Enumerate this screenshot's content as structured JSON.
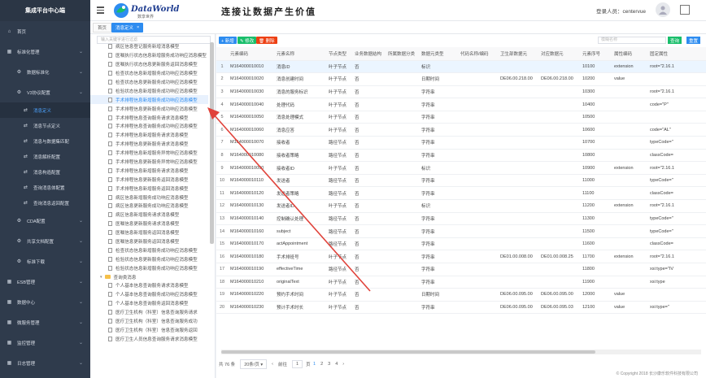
{
  "sidebar": {
    "brand": "集成平台中心端",
    "items": [
      {
        "label": "首页",
        "icon": "home-icon"
      },
      {
        "label": "标准化管理",
        "icon": "grid-icon"
      },
      {
        "label": "数据标准化",
        "icon": "gear-icon"
      },
      {
        "label": "V3协议配置",
        "icon": "gear-icon"
      },
      {
        "label": "消息定义",
        "icon": "pin-icon"
      },
      {
        "label": "消息节点定义",
        "icon": "pin-icon"
      },
      {
        "label": "消息与数据集匹配",
        "icon": "pin-icon"
      },
      {
        "label": "消息解析配置",
        "icon": "pin-icon"
      },
      {
        "label": "消息构造配置",
        "icon": "pin-icon"
      },
      {
        "label": "查询消息体配置",
        "icon": "pin-icon"
      },
      {
        "label": "查询消息返回配置",
        "icon": "pin-icon"
      },
      {
        "label": "CDA配置",
        "icon": "gear-icon"
      },
      {
        "label": "共享文档配置",
        "icon": "gear-icon"
      },
      {
        "label": "标准下载",
        "icon": "gear-icon"
      },
      {
        "label": "ESB管理",
        "icon": "grid-icon"
      },
      {
        "label": "数据中心",
        "icon": "grid-icon"
      },
      {
        "label": "微服务管理",
        "icon": "grid-icon"
      },
      {
        "label": "监控管理",
        "icon": "grid-icon"
      },
      {
        "label": "日志管理",
        "icon": "grid-icon"
      }
    ]
  },
  "header": {
    "logo_text": "DataWorld",
    "logo_sub": "数享世界",
    "slogan": "连接让数据产生价值",
    "login_label": "登录人员：centervue"
  },
  "tabs": {
    "home": "首页",
    "active": "消息定义",
    "close": "×"
  },
  "tree": {
    "search_placeholder": "输入关键字进行过滤",
    "items": [
      "病区信息登记服务新增消息模型",
      "医嘱执行状态信息新增服务成功响应消息模型",
      "医嘱执行状态信息更新服务返回消息模型",
      "检查状态信息新增服务成功响应消息模型",
      "检查状态信息更新服务成功响应消息模型",
      "检验状态信息新增服务成功响应消息模型",
      "手术排程信息新增服务成功响应消息模型",
      "手术排程信息更新服务成功响应消息模型",
      "手术排程信息查询服务请求消息模型",
      "手术排程信息查询服务成功响应消息模型",
      "手术排程信息新增服务请求消息模型",
      "手术排程信息更新服务请求消息模型",
      "手术排程信息新增服务异常响应消息模型",
      "手术排程信息更新服务异常响应消息模型",
      "手术排程信息新增服务请求消息模型",
      "手术排程信息更新服务返回消息模型",
      "手术排程信息新增服务返回消息模型",
      "病区信息新增服务成功响应消息模型",
      "病区信息更新服务成功响应消息模型",
      "病区信息新增服务请求消息模型",
      "医嘱信息更新服务请求消息模型",
      "医嘱信息新增服务返回消息模型",
      "医嘱信息更新服务返回消息模型",
      "检查状态信息新增服务成功响应消息模型",
      "检验状态信息更新服务成功响应消息模型",
      "检验状态信息新增服务成功响应消息模型",
      "个人基本信息查询服务请求消息模型",
      "个人基本信息查询服务成功响应消息模型",
      "个人基本信息查询服务返回消息模型",
      "医疗卫生机构（科室）信息查询服务请求",
      "医疗卫生机构（科室）信息查询服务成功",
      "医疗卫生机构（科室）信息查询服务返回",
      "医疗卫生人员信息查询服务请求消息模型"
    ],
    "folder_label": "查询类消息"
  },
  "toolbar": {
    "add": "+ 新增",
    "edit": "✎ 修改",
    "delete": "🗑 删除",
    "search_placeholder": "模糊名称",
    "query": "查询",
    "reset": "重置"
  },
  "table": {
    "columns": [
      "",
      "元素编码",
      "元素名称",
      "节点类型",
      "业务数据结构",
      "所属数据分类",
      "数据元类型",
      "代码名称/编码",
      "卫生部数据元",
      "对应数据元",
      "元素序号",
      "属性编码",
      "固定属性"
    ],
    "rows": [
      [
        "1",
        "M164000010010",
        "消息ID",
        "叶子节点",
        "否",
        "",
        "标识",
        "",
        "",
        "",
        "10100",
        "extension",
        "root=\"2.16.1"
      ],
      [
        "2",
        "M164000010020",
        "消息创建时间",
        "叶子节点",
        "否",
        "",
        "日期时间",
        "",
        "DE06.00.218.00",
        "DE06.00.218.00",
        "10200",
        "value",
        ""
      ],
      [
        "3",
        "M164000010030",
        "消息的服务标识",
        "叶子节点",
        "否",
        "",
        "字符串",
        "",
        "",
        "",
        "10300",
        "",
        "root=\"2.16.1"
      ],
      [
        "4",
        "M164000010040",
        "处理代码",
        "叶子节点",
        "否",
        "",
        "字符串",
        "",
        "",
        "",
        "10400",
        "",
        "code=\"P\""
      ],
      [
        "5",
        "M164000010050",
        "消息处理模式",
        "叶子节点",
        "否",
        "",
        "字符串",
        "",
        "",
        "",
        "10500",
        "",
        ""
      ],
      [
        "6",
        "M164000010060",
        "消息应答",
        "叶子节点",
        "否",
        "",
        "字符串",
        "",
        "",
        "",
        "10600",
        "",
        "code=\"AL\""
      ],
      [
        "7",
        "M164000010070",
        "接收者",
        "路径节点",
        "否",
        "",
        "字符串",
        "",
        "",
        "",
        "10700",
        "",
        "typeCode=\""
      ],
      [
        "8",
        "M164000010080",
        "接收者策略",
        "路径节点",
        "否",
        "",
        "字符串",
        "",
        "",
        "",
        "10800",
        "",
        "classCode="
      ],
      [
        "9",
        "M164000010090",
        "接收者ID",
        "叶子节点",
        "否",
        "",
        "标识",
        "",
        "",
        "",
        "10900",
        "extension",
        "root=\"2.16.1"
      ],
      [
        "10",
        "M164000010110",
        "发送者",
        "路径节点",
        "否",
        "",
        "字符串",
        "",
        "",
        "",
        "11000",
        "",
        "typeCode=\""
      ],
      [
        "11",
        "M164000010120",
        "发送者策略",
        "路径节点",
        "否",
        "",
        "字符串",
        "",
        "",
        "",
        "11100",
        "",
        "classCode="
      ],
      [
        "12",
        "M164000010130",
        "发送者ID",
        "叶子节点",
        "否",
        "",
        "标识",
        "",
        "",
        "",
        "11200",
        "extension",
        "root=\"2.16.1"
      ],
      [
        "13",
        "M164000010140",
        "控制确认处理",
        "路径节点",
        "否",
        "",
        "字符串",
        "",
        "",
        "",
        "11300",
        "",
        "typeCode=\""
      ],
      [
        "14",
        "M164000010160",
        "subject",
        "路径节点",
        "否",
        "",
        "字符串",
        "",
        "",
        "",
        "11500",
        "",
        "typeCode=\""
      ],
      [
        "15",
        "M164000010170",
        "actAppointment",
        "路径节点",
        "否",
        "",
        "字符串",
        "",
        "",
        "",
        "11600",
        "",
        "classCode="
      ],
      [
        "16",
        "M164000010180",
        "手术排班号",
        "叶子节点",
        "否",
        "",
        "字符串",
        "",
        "DE01.00.008.00",
        "DE01.00.008.25",
        "11700",
        "extension",
        "root=\"2.16.1"
      ],
      [
        "17",
        "M164000010190",
        "effectiveTime",
        "路径节点",
        "否",
        "",
        "字符串",
        "",
        "",
        "",
        "11800",
        "",
        "xsi:type=\"IV"
      ],
      [
        "18",
        "M164000010210",
        "originalText",
        "叶子节点",
        "否",
        "",
        "字符串",
        "",
        "",
        "",
        "11900",
        "",
        "xsi:type"
      ],
      [
        "19",
        "M164000010220",
        "预约手术时间",
        "叶子节点",
        "否",
        "",
        "日期时间",
        "",
        "DE06.00.095.00",
        "DE06.00.095.00",
        "12000",
        "value",
        ""
      ],
      [
        "20",
        "M164000010230",
        "预计手术时长",
        "叶子节点",
        "否",
        "",
        "字符串",
        "",
        "DE06.00.095.00",
        "DE06.00.095.03",
        "12100",
        "value",
        "xsi:type=\""
      ]
    ]
  },
  "pager": {
    "total": "共 76 条",
    "page_size": "20条/页",
    "goto": "前往",
    "page": "1",
    "unit": "页",
    "current": "1",
    "pages": [
      "1",
      "2",
      "3",
      "4"
    ]
  },
  "footer": "© Copyright 2018 长沙康乐软件科技有限公司",
  "colors": {
    "sidebar": "#2f3b4c",
    "accent": "#2d8cf0",
    "success": "#19be6b",
    "danger": "#ed4014",
    "arrow": "#e0423a"
  }
}
